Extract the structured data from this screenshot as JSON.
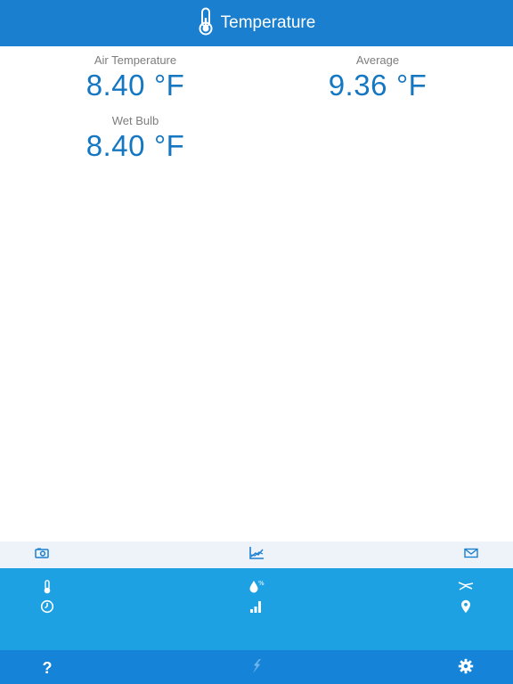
{
  "header": {
    "title": "Temperature",
    "icon": "thermometer-icon"
  },
  "readouts": {
    "air": {
      "label": "Air Temperature",
      "value": "8.40",
      "unit": "°F"
    },
    "average": {
      "label": "Average",
      "value": "9.36",
      "unit": "°F"
    },
    "wet_bulb": {
      "label": "Wet Bulb",
      "value": "8.40",
      "unit": "°F"
    }
  },
  "toolbar": {
    "icons": [
      "camera-icon",
      "graph-icon",
      "mail-icon"
    ]
  },
  "modes": {
    "icons": [
      "thermometer-icon",
      "humidity-icon",
      "wind-icon",
      "gauge-icon",
      "signal-bars-icon",
      "location-pin-icon"
    ]
  },
  "bottombar": {
    "help": "?",
    "icons": [
      "help-icon",
      "brand-logo-icon",
      "settings-gear-icon"
    ]
  },
  "colors": {
    "header": "#1a7fcf",
    "accent_text": "#1577c2",
    "modes_bg": "#1da1e2",
    "bottom_bg": "#1584d8",
    "toolbar_bg": "#edf3f9"
  }
}
